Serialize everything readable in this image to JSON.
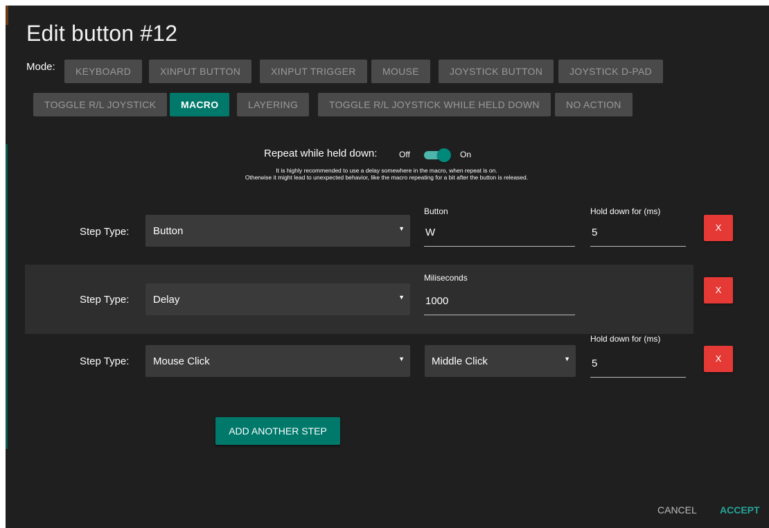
{
  "dialog": {
    "title": "Edit button #12"
  },
  "mode": {
    "label": "Mode:",
    "buttons": [
      {
        "label": "KEYBOARD",
        "active": false
      },
      {
        "label": "XINPUT BUTTON",
        "active": false
      },
      {
        "label": "XINPUT TRIGGER",
        "active": false
      },
      {
        "label": "MOUSE",
        "active": false
      },
      {
        "label": "JOYSTICK BUTTON",
        "active": false
      },
      {
        "label": "JOYSTICK D-PAD",
        "active": false
      },
      {
        "label": "TOGGLE R/L JOYSTICK",
        "active": false
      },
      {
        "label": "MACRO",
        "active": true
      },
      {
        "label": "LAYERING",
        "active": false
      },
      {
        "label": "TOGGLE R/L JOYSTICK WHILE HELD DOWN",
        "active": false
      },
      {
        "label": "NO ACTION",
        "active": false
      }
    ]
  },
  "repeat": {
    "label": "Repeat while held down:",
    "off_label": "Off",
    "on_label": "On",
    "enabled": true,
    "hint_line1": "It is highly recommended to use a delay somewhere in the macro, when repeat is on.",
    "hint_line2": "Otherwise it might lead to unexpected behavior, like the macro repeating for a bit after the button is released."
  },
  "steps": [
    {
      "type_label": "Step Type:",
      "type_value": "Button",
      "field1_label": "Button",
      "field1_value": "W",
      "field2_label": "Hold down for (ms)",
      "field2_value": "5",
      "delete_label": "X"
    },
    {
      "type_label": "Step Type:",
      "type_value": "Delay",
      "field1_label": "Miliseconds",
      "field1_value": "1000",
      "delete_label": "X"
    },
    {
      "type_label": "Step Type:",
      "type_value": "Mouse Click",
      "select2_value": "Middle Click",
      "field2_label": "Hold down for (ms)",
      "field2_value": "5",
      "delete_label": "X"
    }
  ],
  "actions": {
    "add_step": "ADD ANOTHER STEP",
    "cancel": "CANCEL",
    "accept": "ACCEPT"
  },
  "colors": {
    "accent": "#00796b",
    "accent_light": "#26a69a",
    "danger": "#e53935",
    "background": "#1f1f1f"
  }
}
